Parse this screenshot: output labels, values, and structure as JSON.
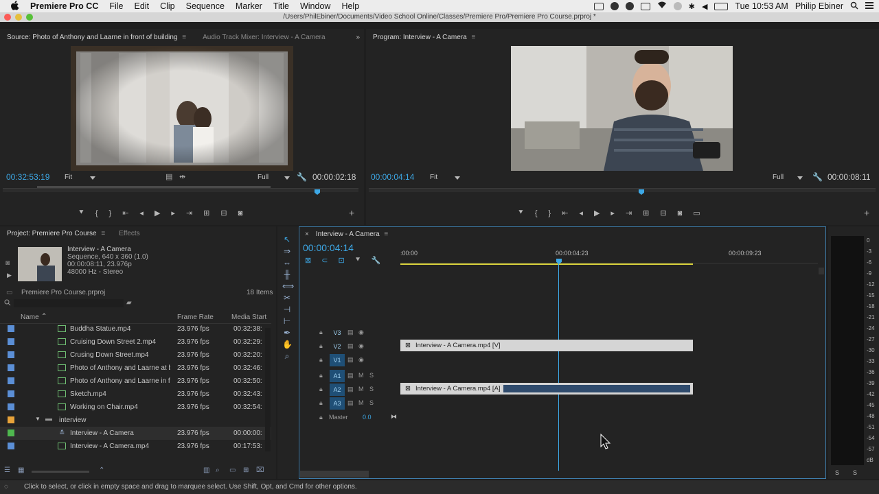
{
  "menubar": {
    "app_name": "Premiere Pro CC",
    "items": [
      "File",
      "Edit",
      "Clip",
      "Sequence",
      "Marker",
      "Title",
      "Window",
      "Help"
    ],
    "clock": "Tue 10:53 AM",
    "user": "Philip Ebiner"
  },
  "window": {
    "title": "/Users/PhilEbiner/Documents/Video School Online/Classes/Premiere Pro/Premiere Pro Course.prproj *"
  },
  "source_monitor": {
    "tab_active": "Source: Photo of Anthony and Laarne in front of building",
    "tab_inactive": "Audio Track Mixer: Interview - A Camera",
    "timecode_current": "00:32:53:19",
    "fit_label": "Fit",
    "resolution_label": "Full",
    "timecode_duration": "00:00:02:18"
  },
  "program_monitor": {
    "tab_active": "Program: Interview - A Camera",
    "timecode_current": "00:00:04:14",
    "fit_label": "Fit",
    "resolution_label": "Full",
    "timecode_duration": "00:00:08:11"
  },
  "project": {
    "tab_active": "Project: Premiere Pro Course",
    "tab_inactive": "Effects",
    "preview": {
      "name": "Interview - A Camera",
      "line1": "Sequence, 640 x 360 (1.0)",
      "line2": "00:00:08:11, 23.976p",
      "line3": "48000 Hz - Stereo"
    },
    "file_name": "Premiere Pro Course.prproj",
    "item_count": "18 Items",
    "columns": {
      "name": "Name",
      "frame_rate": "Frame Rate",
      "media_start": "Media Start"
    },
    "rows": [
      {
        "name": "Buddha Statue.mp4",
        "fps": "23.976 fps",
        "start": "00:32:38:",
        "color": "#5b8fd6"
      },
      {
        "name": "Cruising Down Street 2.mp4",
        "fps": "23.976 fps",
        "start": "00:32:29:",
        "color": "#5b8fd6"
      },
      {
        "name": "Crusing Down Street.mp4",
        "fps": "23.976 fps",
        "start": "00:32:20:",
        "color": "#5b8fd6"
      },
      {
        "name": "Photo of Anthony and Laarne at b",
        "fps": "23.976 fps",
        "start": "00:32:46:",
        "color": "#5b8fd6"
      },
      {
        "name": "Photo of Anthony and Laarne in fr",
        "fps": "23.976 fps",
        "start": "00:32:50:",
        "color": "#5b8fd6"
      },
      {
        "name": "Sketch.mp4",
        "fps": "23.976 fps",
        "start": "00:32:43:",
        "color": "#5b8fd6"
      },
      {
        "name": "Working on Chair.mp4",
        "fps": "23.976 fps",
        "start": "00:32:54:",
        "color": "#5b8fd6"
      }
    ],
    "folder": {
      "name": "interview",
      "color": "#e8a33a"
    },
    "sub_rows": [
      {
        "name": "Interview - A Camera",
        "fps": "23.976 fps",
        "start": "00:00:00:",
        "color": "#4fb84f"
      },
      {
        "name": "Interview - A Camera.mp4",
        "fps": "23.976 fps",
        "start": "00:17:53:",
        "color": "#5b8fd6"
      }
    ]
  },
  "timeline": {
    "tab": "Interview - A Camera",
    "timecode": "00:00:04:14",
    "ruler_labels": [
      ":00:00",
      "00:00:04:23",
      "00:00:09:23"
    ],
    "tracks": {
      "v3": "V3",
      "v2": "V2",
      "v1": "V1",
      "a1": "A1",
      "a2": "A2",
      "a3": "A3",
      "master": "Master",
      "master_value": "0.0"
    },
    "video_clip": "Interview - A Camera.mp4 [V]",
    "audio_clip": "Interview - A Camera.mp4 [A]"
  },
  "meters": {
    "scale": [
      "0",
      "-3",
      "-6",
      "-9",
      "-12",
      "-15",
      "-18",
      "-21",
      "-24",
      "-27",
      "-30",
      "-33",
      "-36",
      "-39",
      "-42",
      "-45",
      "-48",
      "-51",
      "-54",
      "-57",
      "dB"
    ],
    "solo_left": "S",
    "solo_right": "S"
  },
  "statusbar": {
    "text": "Click to select, or click in empty space and drag to marquee select. Use Shift, Opt, and Cmd for other options."
  }
}
